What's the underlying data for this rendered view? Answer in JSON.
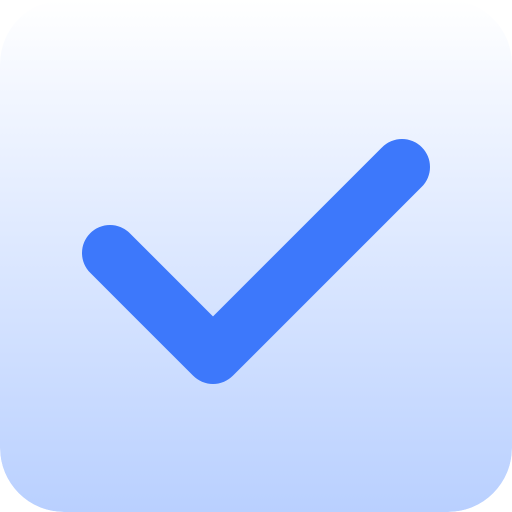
{
  "icon": {
    "name": "checkmark-icon",
    "colors": {
      "background_top": "#ffffff",
      "background_bottom": "#b9d0ff",
      "check": "#3d78fb"
    }
  }
}
